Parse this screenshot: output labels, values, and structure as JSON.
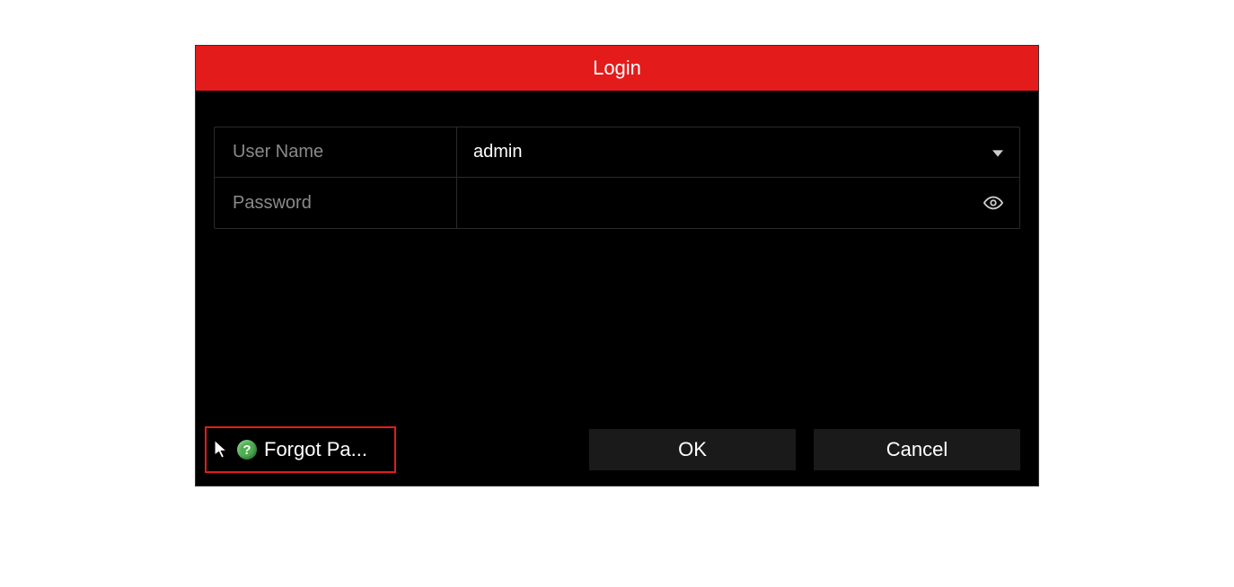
{
  "dialog": {
    "title": "Login"
  },
  "fields": {
    "username": {
      "label": "User Name",
      "value": "admin"
    },
    "password": {
      "label": "Password",
      "value": ""
    }
  },
  "footer": {
    "forgot_label": "Forgot Pa...",
    "help_glyph": "?",
    "ok": "OK",
    "cancel": "Cancel"
  }
}
